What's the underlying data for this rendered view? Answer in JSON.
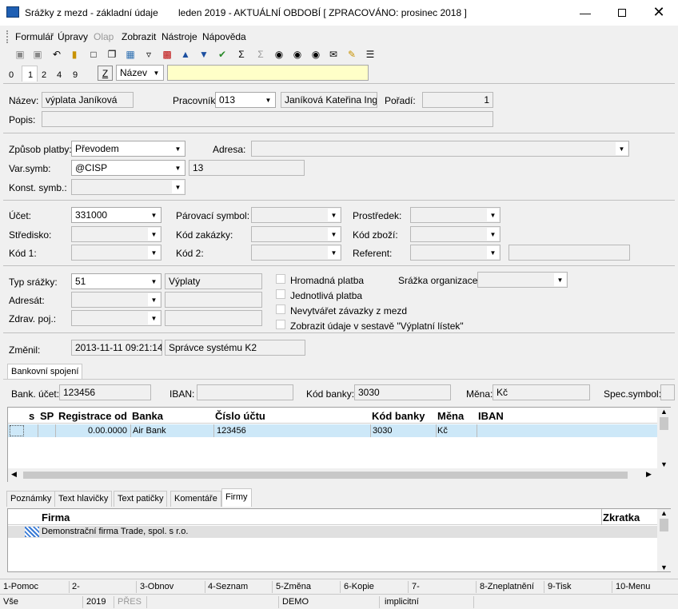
{
  "window": {
    "title": "Srážky z mezd - základní údaje",
    "period": "leden 2019 - AKTUÁLNÍ OBDOBÍ [ ZPRACOVÁNO: prosinec 2018 ]"
  },
  "menu": [
    "Formulář",
    "Úpravy",
    "Olap",
    "Zobrazit",
    "Nástroje",
    "Nápověda"
  ],
  "tabs_top": [
    "0",
    "1",
    "2",
    "4",
    "9"
  ],
  "filter": {
    "z_label": "Z",
    "field": "Název",
    "search_value": ""
  },
  "form": {
    "nazev_label": "Název:",
    "nazev": "výplata Janíková",
    "pracovnik_label": "Pracovník:",
    "pracovnik": "013",
    "pracovnik_name": "Janíková Kateřina Ing.",
    "poradi_label": "Pořadí:",
    "poradi": "1",
    "popis_label": "Popis:",
    "popis": "",
    "zpusob_label": "Způsob platby:",
    "zpusob": "Převodem",
    "adresa_label": "Adresa:",
    "adresa": "",
    "varsymb_label": "Var.symb:",
    "varsymb": "@CISP",
    "varsymb_val": "13",
    "konst_label": "Konst. symb.:",
    "konst": "",
    "ucet_label": "Účet:",
    "ucet": "331000",
    "parovaci_label": "Párovací symbol:",
    "parovaci": "",
    "prostredek_label": "Prostředek:",
    "prostredek": "",
    "stredisko_label": "Středisko:",
    "stredisko": "",
    "zakazka_label": "Kód zakázky:",
    "zakazka": "",
    "zbozi_label": "Kód zboží:",
    "zbozi": "",
    "kod1_label": "Kód 1:",
    "kod1": "",
    "kod2_label": "Kód 2:",
    "kod2": "",
    "referent_label": "Referent:",
    "referent": "",
    "referent_val": "",
    "typ_label": "Typ srážky:",
    "typ": "51",
    "typ_name": "Výplaty",
    "adresat_label": "Adresát:",
    "adresat": "",
    "adresat_val": "",
    "zdrav_label": "Zdrav. poj.:",
    "zdrav": "",
    "zdrav_val": "",
    "chk_hromadna": "Hromadná platba",
    "chk_jednotliva": "Jednotlivá platba",
    "chk_nevytvaret": "Nevytvářet závazky z mezd",
    "chk_zobrazit": "Zobrazit údaje v sestavě \"Výplatní lístek\"",
    "srazka_org_label": "Srážka organizace:",
    "srazka_org": "",
    "zmenil_label": "Změnil:",
    "zmenil_date": "2013-11-11 09:21:14",
    "zmenil_user": "Správce systému K2"
  },
  "bank_tab": "Bankovní spojení",
  "bank": {
    "ucet_label": "Bank. účet:",
    "ucet": "123456",
    "iban_label": "IBAN:",
    "iban": "",
    "kod_label": "Kód banky:",
    "kod": "3030",
    "mena_label": "Měna:",
    "mena": "Kč",
    "spec_label": "Spec.symbol:",
    "spec": ""
  },
  "bank_table": {
    "headers": [
      "s",
      "SP",
      "Registrace od",
      "Banka",
      "Číslo účtu",
      "Kód banky",
      "Měna",
      "IBAN"
    ],
    "rows": [
      [
        "",
        "",
        "0.00.0000",
        "Air Bank",
        "123456",
        "3030",
        "Kč",
        ""
      ]
    ]
  },
  "bottom_tabs": [
    "Poznámky",
    "Text hlavičky",
    "Text patičky",
    "Komentáře",
    "Firmy"
  ],
  "firms_table": {
    "headers": [
      "Firma",
      "Zkratka"
    ],
    "rows": [
      [
        "Demonstrační firma Trade, spol. s r.o.",
        ""
      ]
    ]
  },
  "fkeys": [
    "1-Pomoc",
    "2-",
    "3-Obnov",
    "4-Seznam",
    "5-Změna",
    "6-Kopie",
    "7-",
    "8-Zneplatnění",
    "9-Tisk",
    "10-Menu"
  ],
  "status": [
    "Vše",
    "2019",
    "PŘES",
    "DEMO",
    "implicitní"
  ]
}
